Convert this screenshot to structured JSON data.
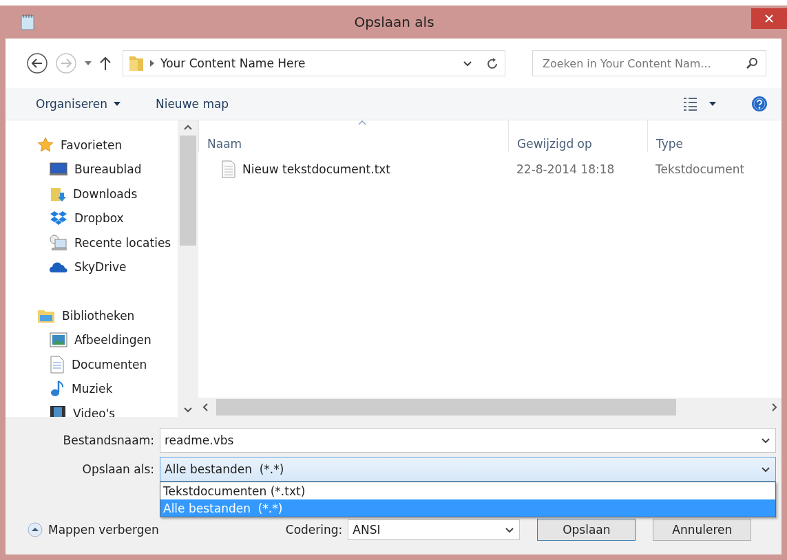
{
  "window": {
    "title": "Opslaan als"
  },
  "address_bar": {
    "path": "Your Content Name Here"
  },
  "search": {
    "placeholder": "Zoeken in Your Content Nam..."
  },
  "toolbar": {
    "organize": "Organiseren",
    "new_folder": "Nieuwe map"
  },
  "sidebar": {
    "groups": [
      {
        "label": "Favorieten",
        "kind": "star",
        "children": [
          {
            "label": "Bureaublad",
            "kind": "desktop"
          },
          {
            "label": "Downloads",
            "kind": "downloads"
          },
          {
            "label": "Dropbox",
            "kind": "dropbox"
          },
          {
            "label": "Recente locaties",
            "kind": "recent"
          },
          {
            "label": "SkyDrive",
            "kind": "cloud"
          }
        ]
      },
      {
        "label": "Bibliotheken",
        "kind": "library",
        "children": [
          {
            "label": "Afbeeldingen",
            "kind": "pictures"
          },
          {
            "label": "Documenten",
            "kind": "documents"
          },
          {
            "label": "Muziek",
            "kind": "music"
          },
          {
            "label": "Video's",
            "kind": "video"
          }
        ]
      }
    ]
  },
  "file_list": {
    "columns": [
      "Naam",
      "Gewijzigd op",
      "Type"
    ],
    "rows": [
      {
        "cells": [
          "Nieuw tekstdocument.txt",
          "22-8-2014 18:18",
          "Tekstdocument"
        ]
      }
    ]
  },
  "form": {
    "filename_label": "Bestandsnaam:",
    "filename": "readme.vbs",
    "type_label": "Opslaan als:",
    "type_value": "Alle bestanden  (*.*)",
    "expanded": true,
    "type_options": [
      {
        "label": "Tekstdocumenten (*.txt)",
        "selected": false
      },
      {
        "label": "Alle bestanden  (*.*)",
        "selected": true
      }
    ]
  },
  "footer": {
    "hide_folders": "Mappen verbergen",
    "encoding_label": "Codering:",
    "encoding": "ANSI",
    "save": "Opslaan",
    "cancel": "Annuleren"
  }
}
